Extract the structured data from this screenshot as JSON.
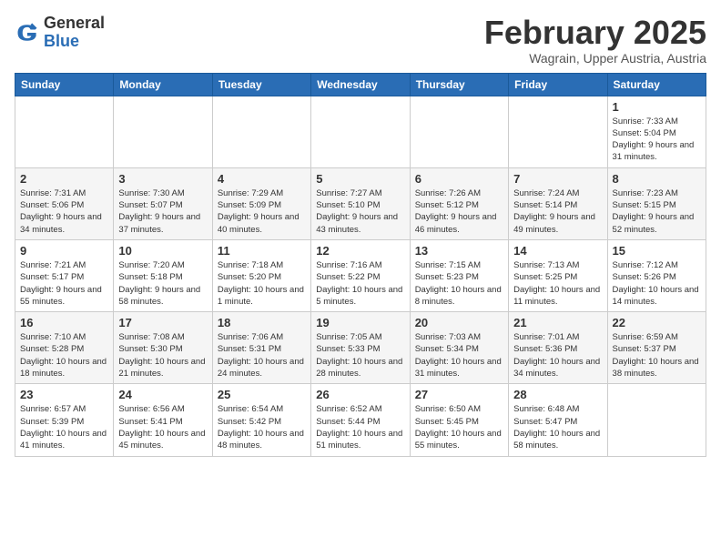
{
  "header": {
    "logo_general": "General",
    "logo_blue": "Blue",
    "title": "February 2025",
    "subtitle": "Wagrain, Upper Austria, Austria"
  },
  "weekdays": [
    "Sunday",
    "Monday",
    "Tuesday",
    "Wednesday",
    "Thursday",
    "Friday",
    "Saturday"
  ],
  "weeks": [
    [
      {
        "day": "",
        "info": ""
      },
      {
        "day": "",
        "info": ""
      },
      {
        "day": "",
        "info": ""
      },
      {
        "day": "",
        "info": ""
      },
      {
        "day": "",
        "info": ""
      },
      {
        "day": "",
        "info": ""
      },
      {
        "day": "1",
        "info": "Sunrise: 7:33 AM\nSunset: 5:04 PM\nDaylight: 9 hours and 31 minutes."
      }
    ],
    [
      {
        "day": "2",
        "info": "Sunrise: 7:31 AM\nSunset: 5:06 PM\nDaylight: 9 hours and 34 minutes."
      },
      {
        "day": "3",
        "info": "Sunrise: 7:30 AM\nSunset: 5:07 PM\nDaylight: 9 hours and 37 minutes."
      },
      {
        "day": "4",
        "info": "Sunrise: 7:29 AM\nSunset: 5:09 PM\nDaylight: 9 hours and 40 minutes."
      },
      {
        "day": "5",
        "info": "Sunrise: 7:27 AM\nSunset: 5:10 PM\nDaylight: 9 hours and 43 minutes."
      },
      {
        "day": "6",
        "info": "Sunrise: 7:26 AM\nSunset: 5:12 PM\nDaylight: 9 hours and 46 minutes."
      },
      {
        "day": "7",
        "info": "Sunrise: 7:24 AM\nSunset: 5:14 PM\nDaylight: 9 hours and 49 minutes."
      },
      {
        "day": "8",
        "info": "Sunrise: 7:23 AM\nSunset: 5:15 PM\nDaylight: 9 hours and 52 minutes."
      }
    ],
    [
      {
        "day": "9",
        "info": "Sunrise: 7:21 AM\nSunset: 5:17 PM\nDaylight: 9 hours and 55 minutes."
      },
      {
        "day": "10",
        "info": "Sunrise: 7:20 AM\nSunset: 5:18 PM\nDaylight: 9 hours and 58 minutes."
      },
      {
        "day": "11",
        "info": "Sunrise: 7:18 AM\nSunset: 5:20 PM\nDaylight: 10 hours and 1 minute."
      },
      {
        "day": "12",
        "info": "Sunrise: 7:16 AM\nSunset: 5:22 PM\nDaylight: 10 hours and 5 minutes."
      },
      {
        "day": "13",
        "info": "Sunrise: 7:15 AM\nSunset: 5:23 PM\nDaylight: 10 hours and 8 minutes."
      },
      {
        "day": "14",
        "info": "Sunrise: 7:13 AM\nSunset: 5:25 PM\nDaylight: 10 hours and 11 minutes."
      },
      {
        "day": "15",
        "info": "Sunrise: 7:12 AM\nSunset: 5:26 PM\nDaylight: 10 hours and 14 minutes."
      }
    ],
    [
      {
        "day": "16",
        "info": "Sunrise: 7:10 AM\nSunset: 5:28 PM\nDaylight: 10 hours and 18 minutes."
      },
      {
        "day": "17",
        "info": "Sunrise: 7:08 AM\nSunset: 5:30 PM\nDaylight: 10 hours and 21 minutes."
      },
      {
        "day": "18",
        "info": "Sunrise: 7:06 AM\nSunset: 5:31 PM\nDaylight: 10 hours and 24 minutes."
      },
      {
        "day": "19",
        "info": "Sunrise: 7:05 AM\nSunset: 5:33 PM\nDaylight: 10 hours and 28 minutes."
      },
      {
        "day": "20",
        "info": "Sunrise: 7:03 AM\nSunset: 5:34 PM\nDaylight: 10 hours and 31 minutes."
      },
      {
        "day": "21",
        "info": "Sunrise: 7:01 AM\nSunset: 5:36 PM\nDaylight: 10 hours and 34 minutes."
      },
      {
        "day": "22",
        "info": "Sunrise: 6:59 AM\nSunset: 5:37 PM\nDaylight: 10 hours and 38 minutes."
      }
    ],
    [
      {
        "day": "23",
        "info": "Sunrise: 6:57 AM\nSunset: 5:39 PM\nDaylight: 10 hours and 41 minutes."
      },
      {
        "day": "24",
        "info": "Sunrise: 6:56 AM\nSunset: 5:41 PM\nDaylight: 10 hours and 45 minutes."
      },
      {
        "day": "25",
        "info": "Sunrise: 6:54 AM\nSunset: 5:42 PM\nDaylight: 10 hours and 48 minutes."
      },
      {
        "day": "26",
        "info": "Sunrise: 6:52 AM\nSunset: 5:44 PM\nDaylight: 10 hours and 51 minutes."
      },
      {
        "day": "27",
        "info": "Sunrise: 6:50 AM\nSunset: 5:45 PM\nDaylight: 10 hours and 55 minutes."
      },
      {
        "day": "28",
        "info": "Sunrise: 6:48 AM\nSunset: 5:47 PM\nDaylight: 10 hours and 58 minutes."
      },
      {
        "day": "",
        "info": ""
      }
    ]
  ]
}
